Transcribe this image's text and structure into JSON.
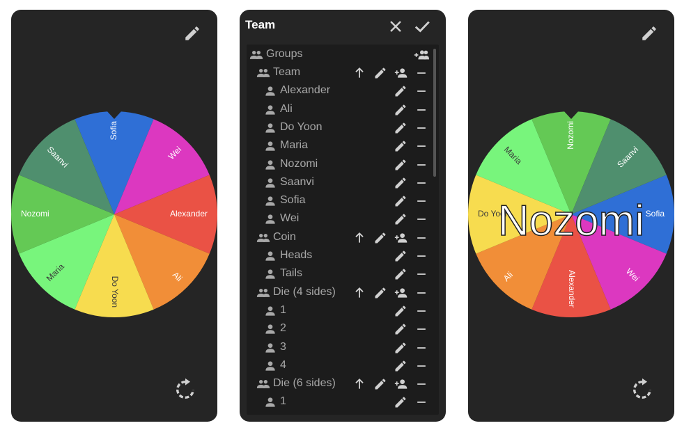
{
  "colors": {
    "panel_bg": "#252525",
    "list_bg": "#1c1c1c",
    "text_dim": "#a8a8a8",
    "icon": "#d0d0d0"
  },
  "wheel": {
    "segments": [
      {
        "label": "Sofia",
        "color": "#2f6fd6"
      },
      {
        "label": "Wei",
        "color": "#dc38c0"
      },
      {
        "label": "Alexander",
        "color": "#ea5245"
      },
      {
        "label": "Ali",
        "color": "#f18e38"
      },
      {
        "label": "Do Yoon",
        "color": "#f7dc4f"
      },
      {
        "label": "Maria",
        "color": "#78f57c"
      },
      {
        "label": "Nozomi",
        "color": "#64c955"
      },
      {
        "label": "Saanvi",
        "color": "#4f8f6e"
      }
    ]
  },
  "icons": {
    "edit": "pencil-icon",
    "spin": "rotate-icon",
    "close": "close-icon",
    "confirm": "check-icon",
    "group": "group-icon",
    "person": "person-icon",
    "add_person": "person-add-icon",
    "move_up": "arrow-up-icon",
    "remove": "minus-icon"
  },
  "editor": {
    "title": "Team",
    "root_label": "Groups",
    "rows": [
      {
        "type": "group",
        "label": "Team"
      },
      {
        "type": "item",
        "label": "Alexander"
      },
      {
        "type": "item",
        "label": "Ali"
      },
      {
        "type": "item",
        "label": "Do Yoon"
      },
      {
        "type": "item",
        "label": "Maria"
      },
      {
        "type": "item",
        "label": "Nozomi"
      },
      {
        "type": "item",
        "label": "Saanvi"
      },
      {
        "type": "item",
        "label": "Sofia"
      },
      {
        "type": "item",
        "label": "Wei"
      },
      {
        "type": "group",
        "label": "Coin"
      },
      {
        "type": "item",
        "label": "Heads"
      },
      {
        "type": "item",
        "label": "Tails"
      },
      {
        "type": "group",
        "label": "Die (4 sides)"
      },
      {
        "type": "item",
        "label": "1"
      },
      {
        "type": "item",
        "label": "2"
      },
      {
        "type": "item",
        "label": "3"
      },
      {
        "type": "item",
        "label": "4"
      },
      {
        "type": "group",
        "label": "Die (6 sides)"
      },
      {
        "type": "item",
        "label": "1"
      }
    ]
  },
  "result": {
    "winner": "Nozomi"
  }
}
